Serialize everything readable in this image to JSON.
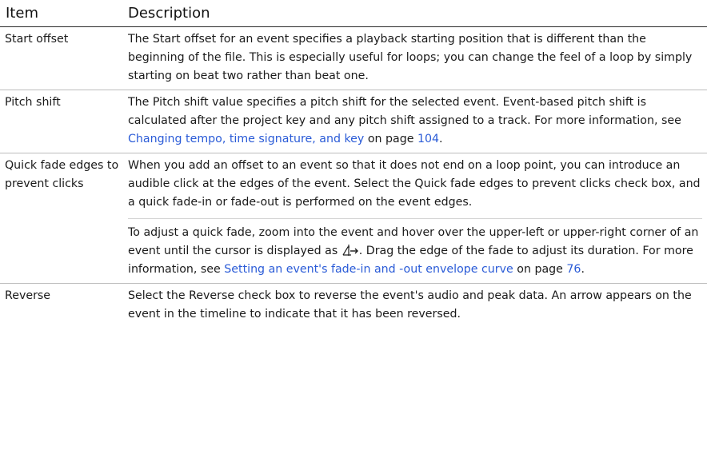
{
  "header": {
    "item": "Item",
    "description": "Description"
  },
  "rows": [
    {
      "item": "Start offset",
      "text": "The Start offset for an event specifies a playback starting position that is different than the beginning of the file. This is especially useful for loops; you can change the feel of a loop by simply starting on beat two rather than beat one."
    },
    {
      "item": "Pitch shift",
      "text_a": "The Pitch shift value specifies a pitch shift for the selected event. Event-based pitch shift is calculated after the project key and any pitch shift assigned to a track. For more information, see ",
      "link": "Changing tempo, time signature, and key",
      "text_b": " on page ",
      "page": "104",
      "text_c": "."
    },
    {
      "item_line1": "Quick fade edges to",
      "item_line2": "prevent clicks",
      "p1": "When you add an offset to an event so that it does not end on a loop point, you can introduce an audible click at the edges of the event. Select the Quick fade edges to prevent clicks check box, and a quick fade-in or fade-out is performed on the event edges.",
      "p2_a": "To adjust a quick fade, zoom into the event and hover over the upper-left or upper-right corner of an event until the cursor is displayed as ",
      "p2_icon": "fade-cursor-icon",
      "p2_b": ". Drag the edge of the fade to adjust its duration. For more information, see ",
      "p2_link": "Setting an event's fade-in and -out envelope curve",
      "p2_c": " on page ",
      "p2_page": "76",
      "p2_d": "."
    },
    {
      "item": "Reverse",
      "text": "Select the Reverse check box to reverse the event's audio and peak data. An arrow appears on the event in the timeline to indicate that it has been reversed."
    }
  ],
  "colors": {
    "link": "#2a5bd7",
    "rule": "#bdbdbd",
    "header_rule": "#2b2b2b"
  }
}
